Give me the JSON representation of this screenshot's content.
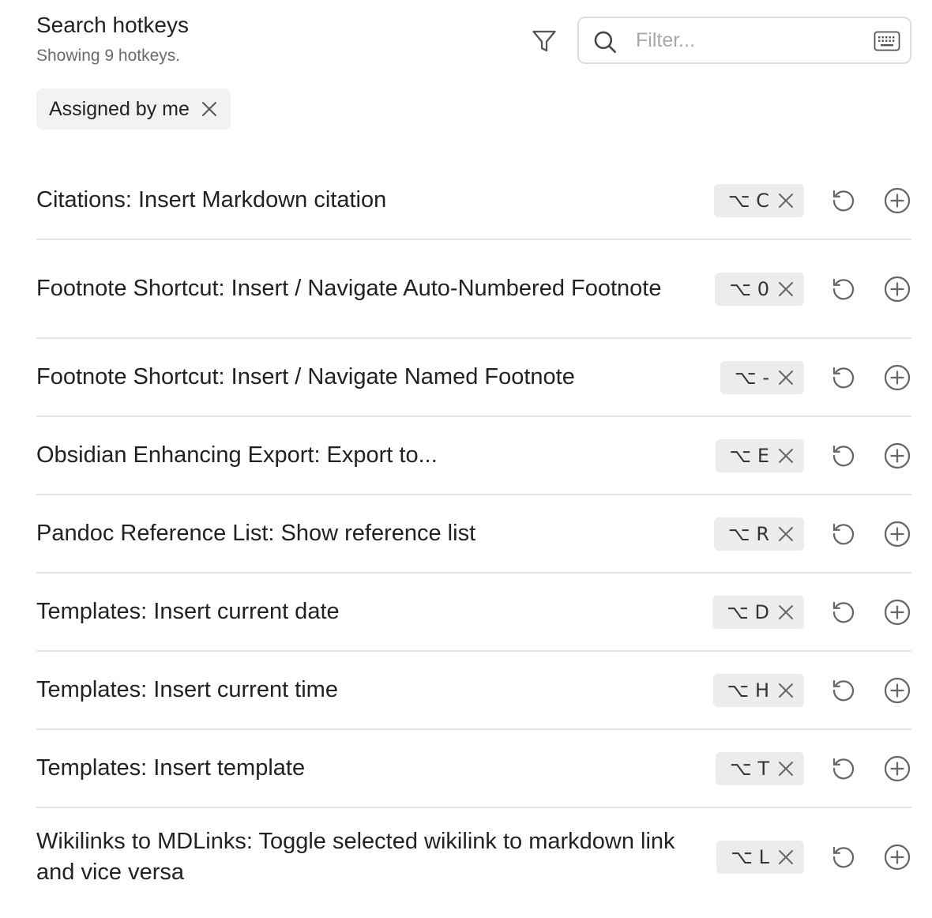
{
  "header": {
    "title": "Search hotkeys",
    "subtitle": "Showing 9 hotkeys."
  },
  "filter_button": {
    "icon": "filter-icon"
  },
  "search": {
    "placeholder": "Filter...",
    "value": "",
    "icon": "search-icon",
    "right_icon": "keyboard-icon"
  },
  "active_filter": {
    "label": "Assigned by me",
    "close_icon": "close-icon"
  },
  "hotkeys": [
    {
      "label": "Citations: Insert Markdown citation",
      "keys": "⌥ C"
    },
    {
      "label": "Footnote Shortcut: Insert / Navigate Auto-Numbered Footnote",
      "keys": "⌥ 0"
    },
    {
      "label": "Footnote Shortcut: Insert / Navigate Named Footnote",
      "keys": "⌥ -"
    },
    {
      "label": "Obsidian Enhancing Export: Export to...",
      "keys": "⌥ E"
    },
    {
      "label": "Pandoc Reference List: Show reference list",
      "keys": "⌥ R"
    },
    {
      "label": "Templates: Insert current date",
      "keys": "⌥ D"
    },
    {
      "label": "Templates: Insert current time",
      "keys": "⌥ H"
    },
    {
      "label": "Templates: Insert template",
      "keys": "⌥ T"
    },
    {
      "label": "Wikilinks to MDLinks: Toggle selected wikilink to markdown link and vice versa",
      "keys": "⌥ L"
    }
  ],
  "colors": {
    "text": "#222222",
    "muted": "#6b6b6b",
    "chip_bg": "#f2f2f2",
    "kbd_bg": "#ececec",
    "divider": "#e4e4e4",
    "icon": "#555555"
  }
}
